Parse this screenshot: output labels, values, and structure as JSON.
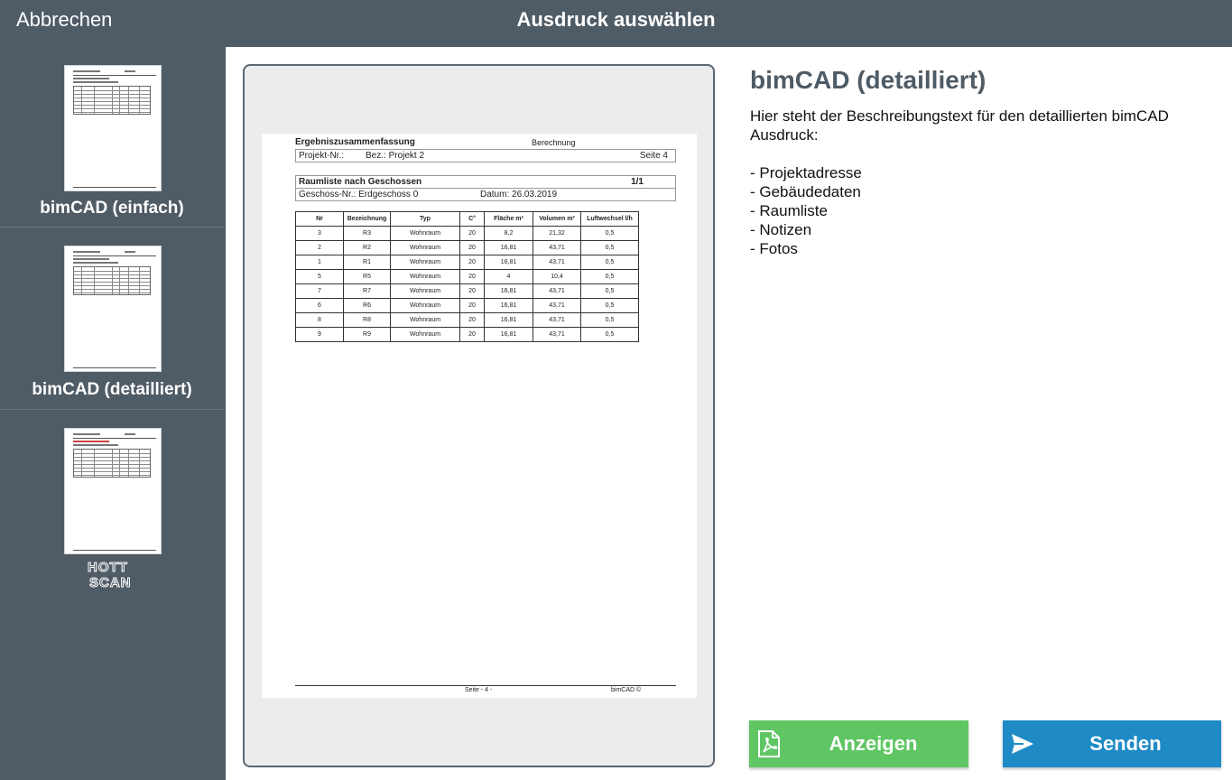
{
  "header": {
    "cancel_label": "Abbrechen",
    "title": "Ausdruck auswählen"
  },
  "sidebar": {
    "items": [
      {
        "label": "bimCAD (einfach)"
      },
      {
        "label": "bimCAD (detailliert)"
      },
      {
        "label": "",
        "logo_text_top": "HOTT",
        "logo_text_bottom": "SCAN"
      }
    ]
  },
  "preview": {
    "doc_title": "Ergebniszusammenfassung",
    "doc_category": "Berechnung",
    "project_nr": "Projekt-Nr.:",
    "project_bez": "Bez.: Projekt 2",
    "page_info": "Seite 4",
    "section_title": "Raumliste nach Geschossen",
    "section_page": "1/1",
    "floor": "Geschoss-Nr.: Erdgeschoss 0",
    "date": "Datum: 26.03.2019",
    "table": {
      "headers": [
        "Nr",
        "Bezeichnung",
        "Typ",
        "C°",
        "Fläche m²",
        "Volumen m³",
        "Luftwechsel l/h"
      ],
      "rows": [
        [
          "3",
          "R3",
          "Wohnraum",
          "20",
          "8,2",
          "21,32",
          "0,5"
        ],
        [
          "2",
          "R2",
          "Wohnraum",
          "20",
          "16,81",
          "43,71",
          "0,5"
        ],
        [
          "1",
          "R1",
          "Wohnraum",
          "20",
          "16,81",
          "43,71",
          "0,5"
        ],
        [
          "5",
          "R5",
          "Wohnraum",
          "20",
          "4",
          "10,4",
          "0,5"
        ],
        [
          "7",
          "R7",
          "Wohnraum",
          "20",
          "16,81",
          "43,71",
          "0,5"
        ],
        [
          "6",
          "R6",
          "Wohnraum",
          "20",
          "16,81",
          "43,71",
          "0,5"
        ],
        [
          "8",
          "R8",
          "Wohnraum",
          "20",
          "16,81",
          "43,71",
          "0,5"
        ],
        [
          "9",
          "R9",
          "Wohnraum",
          "20",
          "16,81",
          "43,71",
          "0,5"
        ]
      ]
    },
    "footer_page": "Seite - 4 -",
    "footer_brand": "bimCAD ©"
  },
  "details": {
    "title": "bimCAD (detailliert)",
    "description": "Hier steht der Beschreibungstext für den detaillierten bimCAD Ausdruck:",
    "list": [
      "- Projektadresse",
      "- Gebäudedaten",
      "- Raumliste",
      "- Notizen",
      "- Fotos"
    ]
  },
  "actions": {
    "show_label": "Anzeigen",
    "send_label": "Senden"
  },
  "colors": {
    "bar": "#4f5b65",
    "show_button": "#5fc663",
    "send_button": "#1e8ac6"
  },
  "icons": {
    "show": "pdf-file-icon",
    "send": "send-icon"
  }
}
